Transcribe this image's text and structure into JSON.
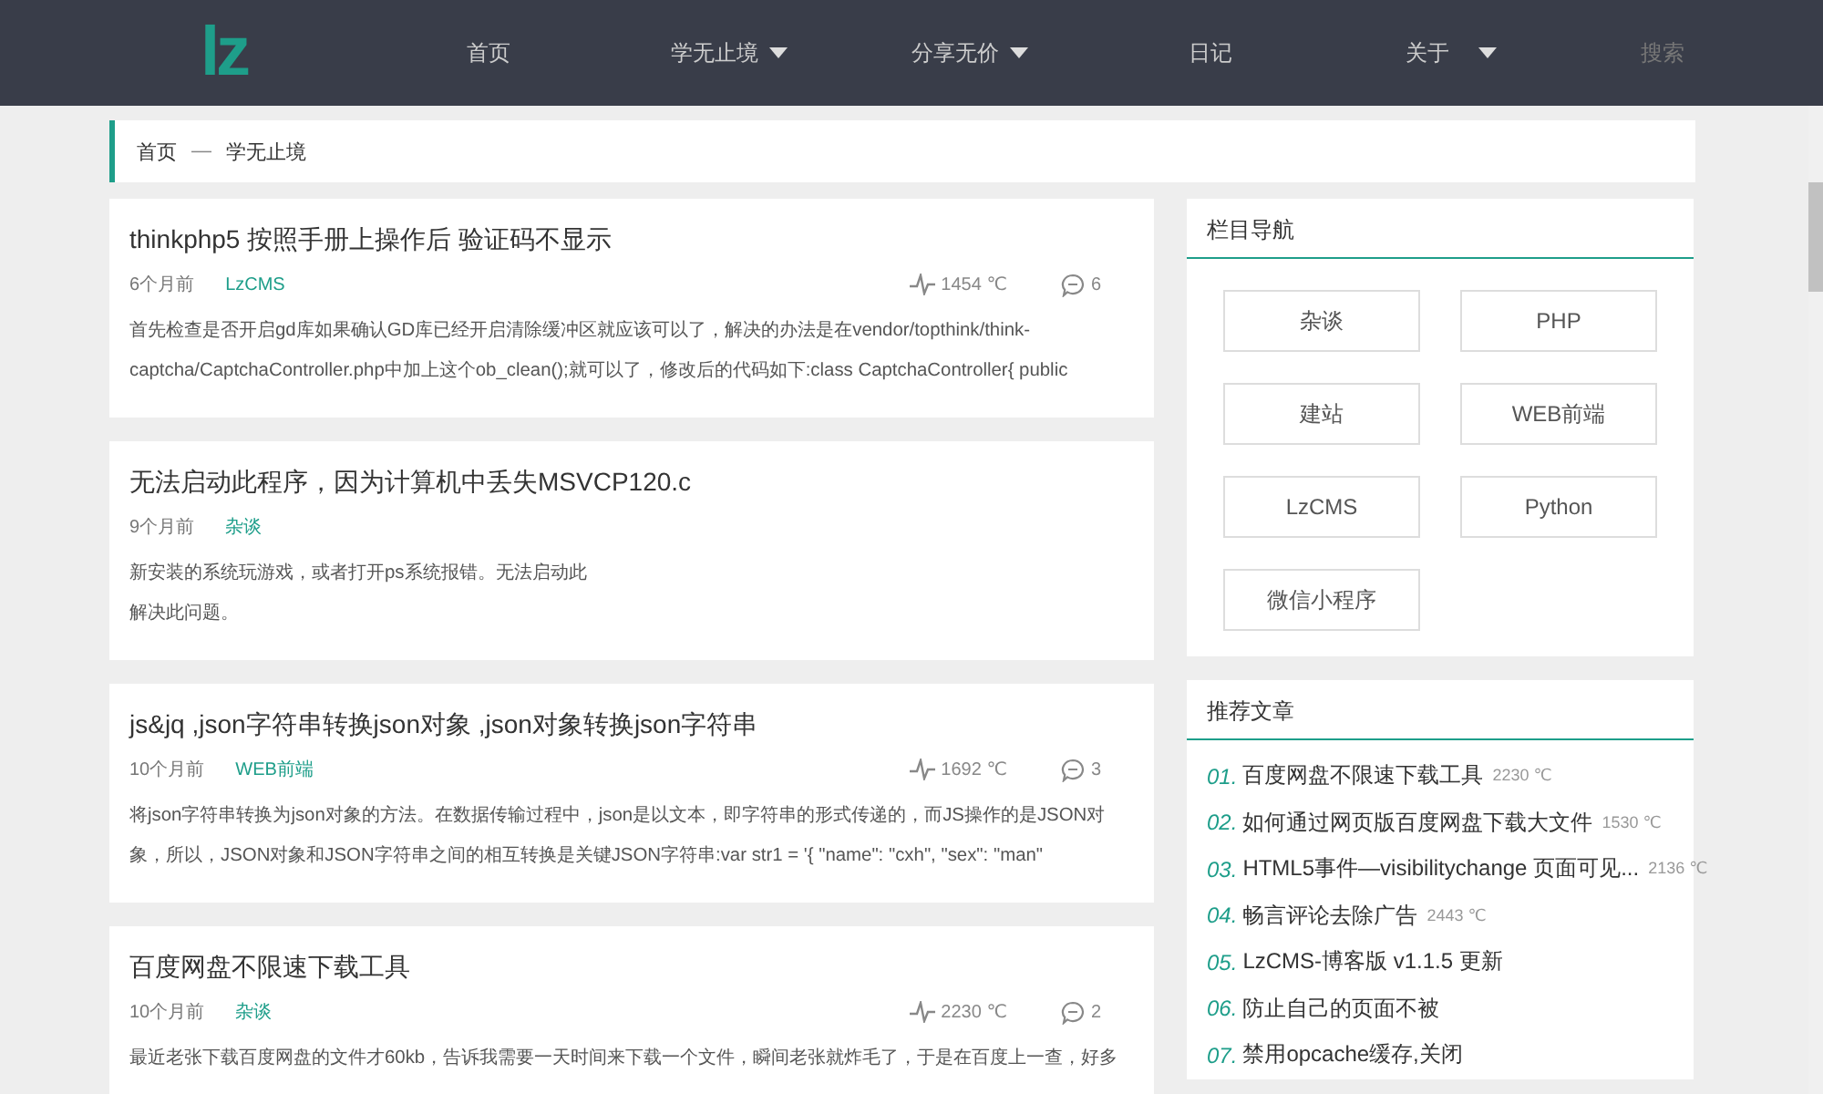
{
  "header": {
    "logo": "lz",
    "nav": [
      {
        "label": "首页",
        "dropdown": false
      },
      {
        "label": "学无止境",
        "dropdown": true
      },
      {
        "label": "分享无价",
        "dropdown": true
      },
      {
        "label": "日记",
        "dropdown": false
      },
      {
        "label": "关于",
        "dropdown": true
      }
    ],
    "search": "搜索"
  },
  "breadcrumb": {
    "items": [
      "首页",
      "学无止境"
    ],
    "separator": "—"
  },
  "articles": [
    {
      "title": "thinkphp5 按照手册上操作后 验证码不显示",
      "time": "6个月前",
      "category": "LzCMS",
      "views": "1454 ℃",
      "comments": "6",
      "excerpt": [
        "首先检查是否开启gd库如果确认GD库已经开启清除缓冲区就应该可以了，解决的办法是在vendor/topthink/think-",
        "captcha/CaptchaController.php中加上这个ob_clean();就可以了，修改后的代码如下:class CaptchaController{     public"
      ]
    },
    {
      "title": "无法启动此程序，因为计算机中丢失MSVCP120.c",
      "time": "9个月前",
      "category": "杂谈",
      "excerpt": [
        "新安装的系统玩游戏，或者打开ps系统报错。无法启动此",
        "解决此问题。"
      ]
    },
    {
      "title": "js&jq ,json字符串转换json对象 ,json对象转换json字符串",
      "time": "10个月前",
      "category": "WEB前端",
      "views": "1692 ℃",
      "comments": "3",
      "excerpt": [
        "将json字符串转换为json对象的方法。在数据传输过程中，json是以文本，即字符串的形式传递的，而JS操作的是JSON对",
        "象，所以，JSON对象和JSON字符串之间的相互转换是关键JSON字符串:var str1 = '{ \"name\": \"cxh\", \"sex\": \"man\""
      ]
    },
    {
      "title": "百度网盘不限速下载工具",
      "time": "10个月前",
      "category": "杂谈",
      "views": "2230 ℃",
      "comments": "2",
      "excerpt": [
        "最近老张下载百度网盘的文件才60kb，告诉我需要一天时间来下载一个文件，瞬间老张就炸毛了，于是在百度上一查，好多"
      ]
    }
  ],
  "sidebar": {
    "nav_title": "栏目导航",
    "categories": [
      "杂谈",
      "PHP",
      "建站",
      "WEB前端",
      "LzCMS",
      "Python",
      "微信小程序"
    ],
    "recommend_title": "推荐文章",
    "recommended": [
      {
        "number": "01.",
        "title": "百度网盘不限速下载工具",
        "views": "2230 ℃"
      },
      {
        "number": "02.",
        "title": "如何通过网页版百度网盘下载大文件",
        "views": "1530 ℃"
      },
      {
        "number": "03.",
        "title": "HTML5事件—visibilitychange 页面可见...",
        "views": "2136 ℃"
      },
      {
        "number": "04.",
        "title": "畅言评论去除广告",
        "views": "2443 ℃"
      },
      {
        "number": "05.",
        "title": "LzCMS-博客版 v1.1.5 更新"
      },
      {
        "number": "06.",
        "title": "防止自己的页面不被"
      },
      {
        "number": "07.",
        "title": "禁用opcache缓存,关闭"
      }
    ]
  }
}
